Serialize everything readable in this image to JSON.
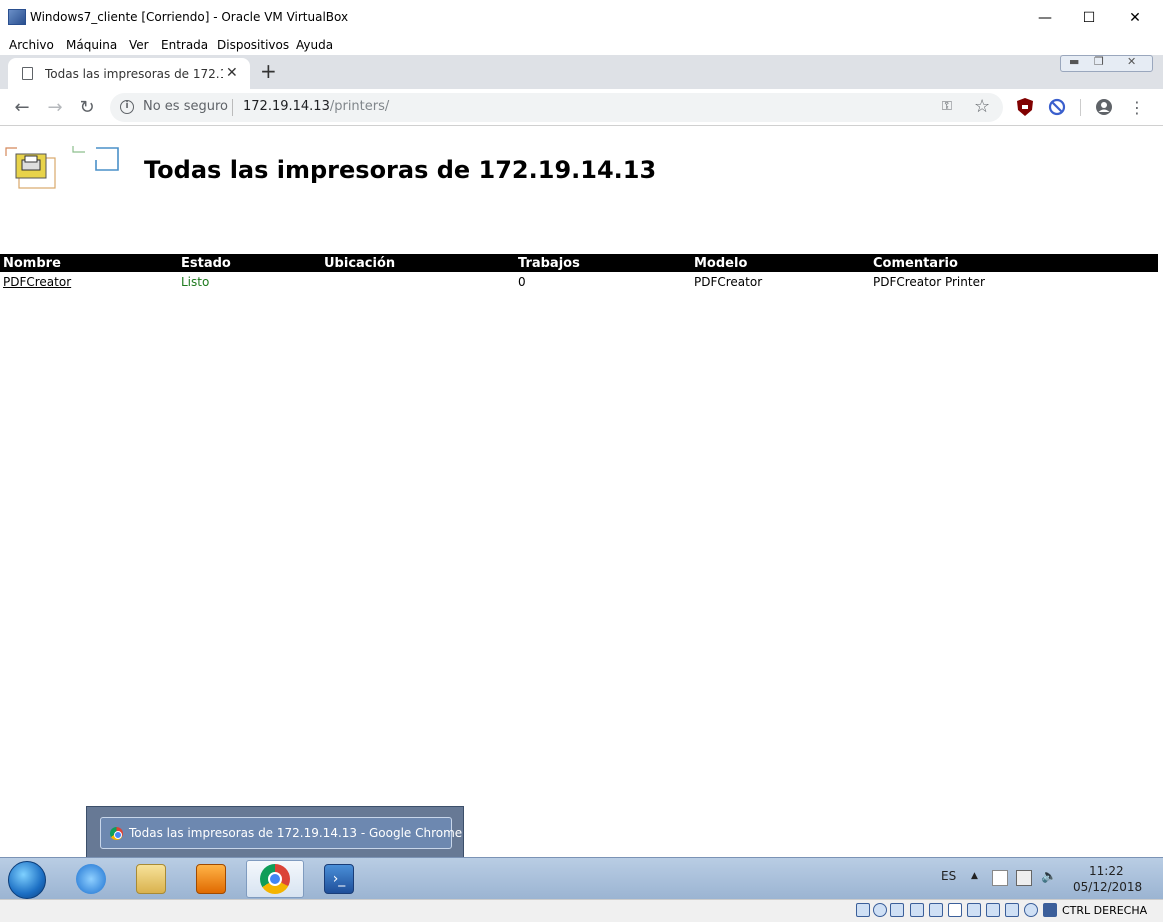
{
  "virtualbox": {
    "window_title": "Windows7_cliente [Corriendo] - Oracle VM VirtualBox",
    "menu": [
      "Archivo",
      "Máquina",
      "Ver",
      "Entrada",
      "Dispositivos",
      "Ayuda"
    ],
    "host_key": "CTRL DERECHA"
  },
  "browser": {
    "tab_title": "Todas las impresoras de 172.19.14.13",
    "security_label": "No es seguro",
    "url_host": "172.19.14.13",
    "url_path": "/printers/"
  },
  "page": {
    "heading": "Todas las impresoras de 172.19.14.13",
    "table": {
      "headers": [
        "Nombre",
        "Estado",
        "Ubicación",
        "Trabajos",
        "Modelo",
        "Comentario"
      ],
      "rows": [
        {
          "nombre": "PDFCreator",
          "estado": "Listo",
          "ubicacion": "",
          "trabajos": "0",
          "modelo": "PDFCreator",
          "comentario": "PDFCreator Printer"
        }
      ]
    }
  },
  "taskbar": {
    "preview_title": "Todas las impresoras de 172.19.14.13 - Google Chrome",
    "language": "ES",
    "clock_time": "11:22",
    "clock_date": "05/12/2018",
    "status_color": "#1e7a1e"
  }
}
